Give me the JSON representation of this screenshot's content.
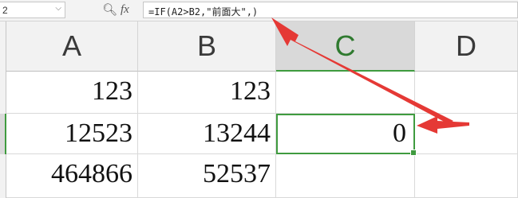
{
  "formula_bar": {
    "name_box_value": "2",
    "zoom_icon": "magnifier-icon",
    "fx_label": "fx",
    "formula": "=IF(A2>B2,\"前面大\",)"
  },
  "columns": [
    "A",
    "B",
    "C",
    "D"
  ],
  "selected_column": "C",
  "rows": [
    {
      "A": "123",
      "B": "123",
      "C": ""
    },
    {
      "A": "12523",
      "B": "13244",
      "C": "0"
    },
    {
      "A": "464866",
      "B": "52537",
      "C": ""
    }
  ],
  "annotation": {
    "arrow_color": "#e53935"
  },
  "colors": {
    "selection": "#3f9b3f",
    "header_bg": "#f2f2f2"
  }
}
